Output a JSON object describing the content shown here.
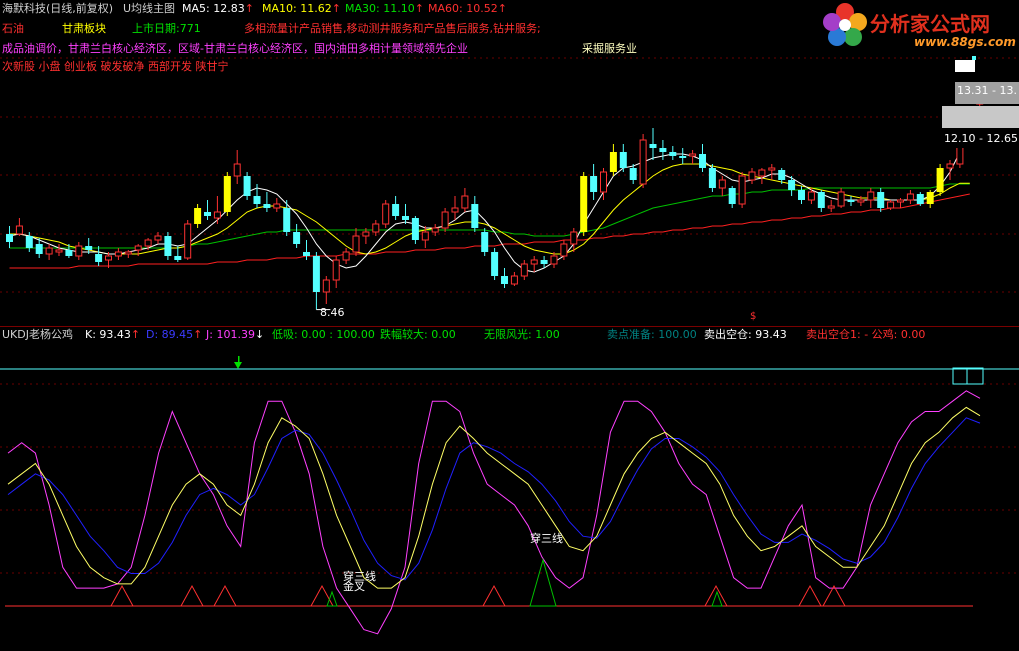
{
  "header": {
    "stock_name": "海默科技(日线,前复权)",
    "indicator_name": "U均线主图",
    "ma5_label": "MA5:",
    "ma5_value": "12.83",
    "ma10_label": "MA10:",
    "ma10_value": "11.62",
    "ma30_label": "MA30:",
    "ma30_value": "11.10",
    "ma60_label": "MA60:",
    "ma60_value": "10.52",
    "up_arrow": "↑",
    "down_arrow": "↓"
  },
  "info": {
    "industry": "石油",
    "region": "甘肃板块",
    "list_date": "上市日期:771",
    "business": "多相流量计产品销售,移动测井服务和产品售后服务,钻井服务;",
    "concepts": "成品油调价，甘肃兰白核心经济区，区域-甘肃兰白核心经济区，国内油田多相计量领域领先企业",
    "sector2": "采掘服务业",
    "tags": "次新股 小盘 创业板 破发破净 西部开发 陕甘宁"
  },
  "logo": {
    "name": "分析家公式网",
    "url": "www.88gs.com"
  },
  "price_labels": {
    "low": "8.46",
    "range1": "13.31 - 13.",
    "range2": "12.10 - 12.65",
    "marker": "$"
  },
  "kdj": {
    "name": "UKDJ老杨公鸡",
    "k": "K: 93.43",
    "d": "D: 89.45",
    "j": "J: 101.39",
    "low_buy": "低吸: 0.00 : 100.00",
    "big_drop": "跌幅较大: 0.00",
    "infinite": "无限风光: 1.00",
    "sell_prep": "卖点准备: 100.00",
    "sell_empty": "卖出空仓: 93.43",
    "sell_empty1": "卖出空仓1: - 公鸡: 0.00",
    "label_cross1": "穿三线",
    "label_cross2": "金叉",
    "label_cross3": "穿三线"
  },
  "colors": {
    "up": "#ff3232",
    "down": "#54ffff",
    "ma5": "#ffffff",
    "ma10": "#ffff00",
    "ma30": "#00c000",
    "ma60": "#ff2020",
    "k": "#ffff66",
    "d": "#2020ff",
    "j": "#ff40ff",
    "yellow_bar": "#ffff00"
  },
  "chart_data": {
    "type": "candlestick",
    "ylim": [
      8.2,
      14.2
    ],
    "candles": [
      {
        "o": 10.35,
        "h": 10.55,
        "l": 10.0,
        "c": 10.15
      },
      {
        "o": 10.35,
        "h": 10.75,
        "l": 10.3,
        "c": 10.55
      },
      {
        "o": 10.3,
        "h": 10.4,
        "l": 9.9,
        "c": 10.0
      },
      {
        "o": 10.1,
        "h": 10.25,
        "l": 9.75,
        "c": 9.85
      },
      {
        "o": 9.85,
        "h": 10.1,
        "l": 9.7,
        "c": 10.0
      },
      {
        "o": 9.9,
        "h": 10.1,
        "l": 9.8,
        "c": 9.95
      },
      {
        "o": 9.95,
        "h": 10.1,
        "l": 9.75,
        "c": 9.8
      },
      {
        "o": 9.8,
        "h": 10.15,
        "l": 9.7,
        "c": 10.05
      },
      {
        "o": 10.05,
        "h": 10.25,
        "l": 9.85,
        "c": 9.95
      },
      {
        "o": 9.85,
        "h": 10.05,
        "l": 9.55,
        "c": 9.65
      },
      {
        "o": 9.7,
        "h": 9.9,
        "l": 9.5,
        "c": 9.8
      },
      {
        "o": 9.8,
        "h": 10.0,
        "l": 9.7,
        "c": 9.9
      },
      {
        "o": 9.85,
        "h": 9.95,
        "l": 9.75,
        "c": 9.9
      },
      {
        "o": 9.95,
        "h": 10.1,
        "l": 9.8,
        "c": 10.05
      },
      {
        "o": 10.05,
        "h": 10.25,
        "l": 9.95,
        "c": 10.2
      },
      {
        "o": 10.2,
        "h": 10.4,
        "l": 10.1,
        "c": 10.3
      },
      {
        "o": 10.3,
        "h": 10.4,
        "l": 9.7,
        "c": 9.8
      },
      {
        "o": 9.8,
        "h": 10.05,
        "l": 9.65,
        "c": 9.7
      },
      {
        "o": 9.75,
        "h": 10.7,
        "l": 9.7,
        "c": 10.6
      },
      {
        "o": 10.6,
        "h": 11.1,
        "l": 10.5,
        "c": 11.0
      },
      {
        "o": 10.9,
        "h": 11.2,
        "l": 10.7,
        "c": 10.8
      },
      {
        "o": 10.75,
        "h": 11.3,
        "l": 10.6,
        "c": 10.9
      },
      {
        "o": 10.9,
        "h": 11.9,
        "l": 10.8,
        "c": 11.8
      },
      {
        "o": 11.8,
        "h": 12.45,
        "l": 11.6,
        "c": 12.1
      },
      {
        "o": 11.8,
        "h": 11.9,
        "l": 11.2,
        "c": 11.3
      },
      {
        "o": 11.3,
        "h": 11.6,
        "l": 11.0,
        "c": 11.1
      },
      {
        "o": 11.1,
        "h": 11.4,
        "l": 10.9,
        "c": 11.0
      },
      {
        "o": 11.0,
        "h": 11.25,
        "l": 10.9,
        "c": 11.1
      },
      {
        "o": 11.0,
        "h": 11.2,
        "l": 10.3,
        "c": 10.4
      },
      {
        "o": 10.4,
        "h": 10.6,
        "l": 10.0,
        "c": 10.1
      },
      {
        "o": 9.9,
        "h": 10.2,
        "l": 9.7,
        "c": 9.8
      },
      {
        "o": 9.8,
        "h": 9.9,
        "l": 8.46,
        "c": 8.9
      },
      {
        "o": 8.9,
        "h": 9.3,
        "l": 8.6,
        "c": 9.2
      },
      {
        "o": 9.2,
        "h": 9.8,
        "l": 9.0,
        "c": 9.7
      },
      {
        "o": 9.7,
        "h": 10.0,
        "l": 9.6,
        "c": 9.9
      },
      {
        "o": 9.9,
        "h": 10.5,
        "l": 9.8,
        "c": 10.3
      },
      {
        "o": 10.3,
        "h": 10.5,
        "l": 10.1,
        "c": 10.4
      },
      {
        "o": 10.4,
        "h": 10.7,
        "l": 10.3,
        "c": 10.6
      },
      {
        "o": 10.6,
        "h": 11.2,
        "l": 10.5,
        "c": 11.1
      },
      {
        "o": 11.1,
        "h": 11.3,
        "l": 10.7,
        "c": 10.8
      },
      {
        "o": 10.8,
        "h": 11.1,
        "l": 10.6,
        "c": 10.7
      },
      {
        "o": 10.75,
        "h": 10.8,
        "l": 10.1,
        "c": 10.2
      },
      {
        "o": 10.2,
        "h": 10.55,
        "l": 10.0,
        "c": 10.4
      },
      {
        "o": 10.4,
        "h": 10.6,
        "l": 10.3,
        "c": 10.5
      },
      {
        "o": 10.5,
        "h": 11.0,
        "l": 10.4,
        "c": 10.9
      },
      {
        "o": 10.9,
        "h": 11.3,
        "l": 10.7,
        "c": 11.0
      },
      {
        "o": 11.0,
        "h": 11.5,
        "l": 10.9,
        "c": 11.3
      },
      {
        "o": 11.1,
        "h": 11.3,
        "l": 10.4,
        "c": 10.5
      },
      {
        "o": 10.4,
        "h": 10.5,
        "l": 9.8,
        "c": 9.9
      },
      {
        "o": 9.9,
        "h": 10.0,
        "l": 9.2,
        "c": 9.3
      },
      {
        "o": 9.3,
        "h": 9.5,
        "l": 9.0,
        "c": 9.1
      },
      {
        "o": 9.1,
        "h": 9.4,
        "l": 9.05,
        "c": 9.3
      },
      {
        "o": 9.3,
        "h": 9.7,
        "l": 9.2,
        "c": 9.6
      },
      {
        "o": 9.6,
        "h": 9.8,
        "l": 9.4,
        "c": 9.7
      },
      {
        "o": 9.7,
        "h": 9.8,
        "l": 9.5,
        "c": 9.6
      },
      {
        "o": 9.6,
        "h": 9.9,
        "l": 9.5,
        "c": 9.8
      },
      {
        "o": 9.8,
        "h": 10.2,
        "l": 9.7,
        "c": 10.1
      },
      {
        "o": 10.1,
        "h": 10.5,
        "l": 9.9,
        "c": 10.4
      },
      {
        "o": 10.4,
        "h": 11.9,
        "l": 10.3,
        "c": 11.8
      },
      {
        "o": 11.8,
        "h": 12.1,
        "l": 11.2,
        "c": 11.4
      },
      {
        "o": 11.4,
        "h": 12.0,
        "l": 11.2,
        "c": 11.9
      },
      {
        "o": 11.9,
        "h": 12.6,
        "l": 11.8,
        "c": 12.4
      },
      {
        "o": 12.4,
        "h": 12.6,
        "l": 11.9,
        "c": 12.0
      },
      {
        "o": 12.0,
        "h": 12.1,
        "l": 11.6,
        "c": 11.7
      },
      {
        "o": 11.6,
        "h": 12.85,
        "l": 11.5,
        "c": 12.7
      },
      {
        "o": 12.6,
        "h": 13.0,
        "l": 12.2,
        "c": 12.5
      },
      {
        "o": 12.5,
        "h": 12.7,
        "l": 12.2,
        "c": 12.4
      },
      {
        "o": 12.4,
        "h": 12.55,
        "l": 12.2,
        "c": 12.3
      },
      {
        "o": 12.3,
        "h": 12.5,
        "l": 12.1,
        "c": 12.25
      },
      {
        "o": 12.3,
        "h": 12.45,
        "l": 12.1,
        "c": 12.35
      },
      {
        "o": 12.35,
        "h": 12.6,
        "l": 11.9,
        "c": 12.0
      },
      {
        "o": 12.0,
        "h": 12.1,
        "l": 11.4,
        "c": 11.5
      },
      {
        "o": 11.5,
        "h": 11.8,
        "l": 11.3,
        "c": 11.7
      },
      {
        "o": 11.5,
        "h": 11.55,
        "l": 11.0,
        "c": 11.1
      },
      {
        "o": 11.1,
        "h": 11.9,
        "l": 11.0,
        "c": 11.8
      },
      {
        "o": 11.7,
        "h": 12.0,
        "l": 11.6,
        "c": 11.9
      },
      {
        "o": 11.8,
        "h": 12.0,
        "l": 11.6,
        "c": 11.95
      },
      {
        "o": 11.95,
        "h": 12.1,
        "l": 11.7,
        "c": 12.0
      },
      {
        "o": 11.95,
        "h": 12.0,
        "l": 11.6,
        "c": 11.7
      },
      {
        "o": 11.7,
        "h": 11.8,
        "l": 11.3,
        "c": 11.45
      },
      {
        "o": 11.45,
        "h": 11.55,
        "l": 11.1,
        "c": 11.2
      },
      {
        "o": 11.2,
        "h": 11.5,
        "l": 11.1,
        "c": 11.4
      },
      {
        "o": 11.4,
        "h": 11.45,
        "l": 10.9,
        "c": 11.0
      },
      {
        "o": 11.0,
        "h": 11.2,
        "l": 10.9,
        "c": 11.05
      },
      {
        "o": 11.05,
        "h": 11.5,
        "l": 11.0,
        "c": 11.4
      },
      {
        "o": 11.2,
        "h": 11.3,
        "l": 11.05,
        "c": 11.15
      },
      {
        "o": 11.15,
        "h": 11.3,
        "l": 11.05,
        "c": 11.2
      },
      {
        "o": 11.2,
        "h": 11.5,
        "l": 11.0,
        "c": 11.4
      },
      {
        "o": 11.4,
        "h": 11.5,
        "l": 10.9,
        "c": 11.0
      },
      {
        "o": 11.0,
        "h": 11.2,
        "l": 10.95,
        "c": 11.15
      },
      {
        "o": 11.15,
        "h": 11.25,
        "l": 11.0,
        "c": 11.2
      },
      {
        "o": 11.2,
        "h": 11.45,
        "l": 11.1,
        "c": 11.35
      },
      {
        "o": 11.35,
        "h": 11.4,
        "l": 11.05,
        "c": 11.1
      },
      {
        "o": 11.1,
        "h": 11.45,
        "l": 11.0,
        "c": 11.4
      },
      {
        "o": 11.4,
        "h": 12.1,
        "l": 11.3,
        "c": 12.0
      },
      {
        "o": 12.0,
        "h": 12.2,
        "l": 11.7,
        "c": 12.1
      },
      {
        "o": 12.1,
        "h": 12.8,
        "l": 12.0,
        "c": 12.7
      },
      {
        "o": 12.7,
        "h": 13.35,
        "l": 12.6,
        "c": 13.31
      },
      {
        "o": 13.6,
        "h": 14.0,
        "l": 13.5,
        "c": 13.8
      }
    ],
    "yellow_bar_indices": [
      19,
      22,
      58,
      61,
      93,
      94
    ],
    "ma5": [
      10.3,
      10.35,
      10.3,
      10.2,
      10.1,
      10.0,
      9.95,
      9.9,
      9.9,
      9.9,
      9.85,
      9.85,
      9.9,
      9.95,
      10.0,
      10.1,
      10.1,
      10.05,
      10.1,
      10.3,
      10.5,
      10.7,
      10.95,
      11.2,
      11.4,
      11.5,
      11.45,
      11.35,
      11.1,
      10.85,
      10.5,
      10.1,
      9.8,
      9.6,
      9.5,
      9.55,
      9.8,
      10.1,
      10.4,
      10.6,
      10.65,
      10.6,
      10.5,
      10.5,
      10.55,
      10.7,
      10.9,
      10.95,
      10.7,
      10.4,
      10.0,
      9.65,
      9.45,
      9.4,
      9.5,
      9.65,
      9.8,
      10.1,
      10.6,
      11.0,
      11.4,
      11.8,
      12.0,
      12.05,
      12.15,
      12.25,
      12.3,
      12.35,
      12.35,
      12.3,
      12.2,
      12.0,
      11.85,
      11.7,
      11.65,
      11.7,
      11.75,
      11.85,
      11.85,
      11.75,
      11.6,
      11.45,
      11.35,
      11.25,
      11.2,
      11.2,
      11.2,
      11.2,
      11.2,
      11.2,
      11.2,
      11.2,
      11.2,
      11.3,
      11.55,
      11.9,
      12.4,
      12.83
    ],
    "ma10": [
      10.35,
      10.35,
      10.3,
      10.25,
      10.2,
      10.15,
      10.05,
      10.0,
      9.95,
      9.9,
      9.85,
      9.85,
      9.85,
      9.85,
      9.9,
      9.95,
      10.0,
      10.0,
      10.05,
      10.15,
      10.25,
      10.35,
      10.5,
      10.7,
      10.9,
      11.0,
      11.05,
      11.05,
      11.0,
      10.95,
      10.8,
      10.65,
      10.45,
      10.25,
      10.05,
      9.9,
      9.85,
      9.9,
      10.0,
      10.15,
      10.3,
      10.4,
      10.45,
      10.5,
      10.55,
      10.6,
      10.65,
      10.65,
      10.6,
      10.5,
      10.35,
      10.2,
      10.05,
      9.95,
      9.9,
      9.85,
      9.85,
      9.95,
      10.1,
      10.35,
      10.65,
      10.95,
      11.2,
      11.4,
      11.6,
      11.8,
      11.95,
      12.05,
      12.1,
      12.1,
      12.1,
      12.05,
      12.0,
      11.95,
      11.85,
      11.8,
      11.75,
      11.7,
      11.65,
      11.6,
      11.55,
      11.5,
      11.45,
      11.4,
      11.35,
      11.3,
      11.25,
      11.25,
      11.25,
      11.2,
      11.2,
      11.2,
      11.2,
      11.25,
      11.35,
      11.5,
      11.62,
      11.62
    ],
    "ma30": [
      10.0,
      10.0,
      10.0,
      10.0,
      10.0,
      10.0,
      10.0,
      10.0,
      10.0,
      10.0,
      10.0,
      10.0,
      10.0,
      10.0,
      10.0,
      10.0,
      10.0,
      10.0,
      10.05,
      10.1,
      10.1,
      10.15,
      10.2,
      10.25,
      10.3,
      10.35,
      10.4,
      10.4,
      10.45,
      10.45,
      10.45,
      10.45,
      10.45,
      10.45,
      10.45,
      10.45,
      10.45,
      10.45,
      10.45,
      10.45,
      10.45,
      10.45,
      10.45,
      10.45,
      10.45,
      10.45,
      10.45,
      10.45,
      10.45,
      10.4,
      10.4,
      10.35,
      10.35,
      10.3,
      10.3,
      10.3,
      10.3,
      10.35,
      10.4,
      10.45,
      10.5,
      10.6,
      10.7,
      10.8,
      10.9,
      11.0,
      11.05,
      11.1,
      11.15,
      11.2,
      11.25,
      11.3,
      11.3,
      11.35,
      11.35,
      11.4,
      11.4,
      11.45,
      11.45,
      11.45,
      11.45,
      11.5,
      11.5,
      11.5,
      11.5,
      11.5,
      11.5,
      11.5,
      11.5,
      11.5,
      11.5,
      11.5,
      11.5,
      11.5,
      11.55,
      11.6,
      11.6,
      11.6
    ],
    "ma60": [
      9.5,
      9.5,
      9.5,
      9.5,
      9.5,
      9.5,
      9.5,
      9.55,
      9.55,
      9.55,
      9.55,
      9.55,
      9.55,
      9.6,
      9.6,
      9.6,
      9.6,
      9.6,
      9.6,
      9.6,
      9.6,
      9.65,
      9.65,
      9.65,
      9.7,
      9.7,
      9.7,
      9.75,
      9.75,
      9.75,
      9.8,
      9.8,
      9.8,
      9.8,
      9.85,
      9.85,
      9.85,
      9.85,
      9.9,
      9.9,
      9.9,
      9.95,
      9.95,
      9.95,
      10.0,
      10.0,
      10.0,
      10.05,
      10.05,
      10.05,
      10.1,
      10.1,
      10.1,
      10.15,
      10.15,
      10.15,
      10.2,
      10.2,
      10.2,
      10.25,
      10.25,
      10.3,
      10.3,
      10.35,
      10.35,
      10.4,
      10.4,
      10.45,
      10.45,
      10.5,
      10.5,
      10.55,
      10.55,
      10.6,
      10.6,
      10.65,
      10.65,
      10.7,
      10.7,
      10.75,
      10.75,
      10.8,
      10.8,
      10.85,
      10.85,
      10.9,
      10.9,
      10.95,
      10.95,
      11.0,
      11.0,
      11.05,
      11.1,
      11.15,
      11.2,
      11.25,
      11.3,
      11.35
    ],
    "kdj": {
      "ylim": [
        -15,
        115
      ],
      "k": [
        60,
        65,
        70,
        60,
        45,
        30,
        20,
        15,
        12,
        12,
        20,
        35,
        50,
        60,
        65,
        60,
        50,
        45,
        60,
        80,
        92,
        88,
        82,
        65,
        45,
        30,
        15,
        10,
        10,
        15,
        35,
        60,
        80,
        88,
        82,
        75,
        70,
        65,
        60,
        50,
        40,
        30,
        28,
        35,
        50,
        65,
        75,
        82,
        85,
        80,
        75,
        70,
        60,
        45,
        35,
        28,
        30,
        35,
        40,
        30,
        25,
        20,
        20,
        30,
        40,
        55,
        70,
        80,
        85,
        92,
        97,
        93
      ],
      "d": [
        55,
        60,
        65,
        62,
        55,
        45,
        35,
        28,
        20,
        17,
        17,
        22,
        32,
        45,
        55,
        58,
        55,
        50,
        55,
        68,
        82,
        86,
        84,
        75,
        62,
        48,
        33,
        22,
        16,
        14,
        22,
        38,
        58,
        75,
        80,
        78,
        75,
        70,
        66,
        60,
        52,
        42,
        35,
        34,
        42,
        55,
        67,
        77,
        82,
        82,
        78,
        73,
        66,
        55,
        45,
        36,
        32,
        32,
        36,
        33,
        29,
        24,
        22,
        25,
        32,
        44,
        58,
        70,
        78,
        85,
        92,
        89.45
      ],
      "j": [
        75,
        80,
        75,
        50,
        20,
        10,
        10,
        10,
        12,
        20,
        45,
        75,
        95,
        80,
        65,
        55,
        40,
        30,
        80,
        100,
        100,
        85,
        65,
        30,
        10,
        0,
        -10,
        -12,
        0,
        20,
        70,
        100,
        100,
        95,
        75,
        60,
        55,
        50,
        40,
        25,
        15,
        10,
        15,
        45,
        85,
        100,
        100,
        95,
        85,
        70,
        60,
        55,
        35,
        15,
        10,
        10,
        25,
        40,
        50,
        15,
        10,
        10,
        20,
        50,
        65,
        80,
        90,
        95,
        95,
        100,
        105,
        101.39
      ]
    }
  }
}
